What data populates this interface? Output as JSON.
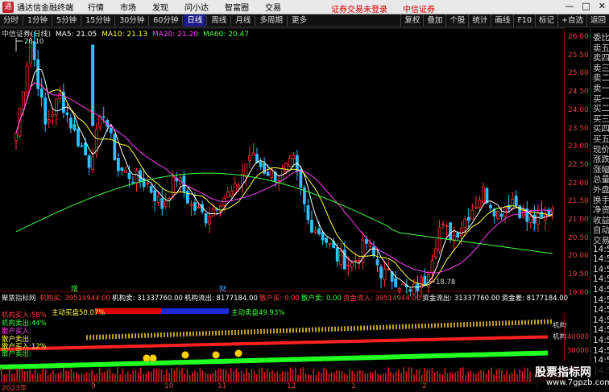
{
  "menubar": {
    "logo_text": "通",
    "app_title": "通达信金融终端",
    "items": [
      "行情",
      "市场",
      "发现",
      "问小达",
      "智富圈",
      "交易"
    ],
    "notice_left": "证券交易未登录",
    "notice_right": "中信证券",
    "win_buttons": [
      "—",
      "□",
      "✕"
    ]
  },
  "toolbar": {
    "periods": [
      "分时",
      "1分钟",
      "5分钟",
      "15分钟",
      "30分钟",
      "60分钟",
      "日线",
      "周线",
      "月线",
      "多周期",
      "更多"
    ],
    "active_period": "日线",
    "right_buttons": [
      "复权",
      "叠加",
      "个股",
      "统计",
      "画线",
      "F10",
      "标记",
      "+自选",
      "返回"
    ]
  },
  "legend": {
    "stock": "中信证券(日线)",
    "ma5": "MA5: 21.05",
    "ma10": "MA10: 21.13",
    "ma20": "MA20: 21.20",
    "ma60": "MA60: 20.47"
  },
  "price_axis": [
    "26.00",
    "25.50",
    "25.00",
    "24.50",
    "24.00",
    "23.50",
    "23.00",
    "22.50",
    "22.00",
    "21.50",
    "21.00",
    "20.50",
    "20.00",
    "19.50",
    "19.00"
  ],
  "annotations": {
    "high": "26.10",
    "low": "18.78",
    "marker1": "增",
    "marker2": "财"
  },
  "indicator": {
    "name": "聚票指标网",
    "items": [
      {
        "label": "机构买: 39514944.00",
        "color": "#ff4040"
      },
      {
        "label": "机构卖: 31337760.00",
        "color": "#ffffff"
      },
      {
        "label": "机构流出: 8177184.00",
        "color": "#ffffff"
      },
      {
        "label": "散户买: 0.00",
        "color": "#ff4040"
      },
      {
        "label": "散户卖: 0.00",
        "color": "#40ff40"
      },
      {
        "label": "资金流入: 39514944.00",
        "color": "#ff4040"
      },
      {
        "label": "资金流出: 31337760.00",
        "color": "#ffffff"
      },
      {
        "label": "资金差: 8177184.00",
        "color": "#ffffff"
      }
    ],
    "buy_pct": "机构买入:58%",
    "sell_pct": "机构卖出:44%",
    "retail_buy": "散户买入:",
    "retail_line2": "散户卖出:",
    "retail_in": "散户买入:12%",
    "retail_sell": "散户卖出:",
    "active_buy": "主动买盘50.07%",
    "active_sell": "主动卖盘49.93%",
    "side_label1": "机构",
    "side_label2": "机构"
  },
  "vol_axis": [
    "40000",
    "30000",
    "20000"
  ],
  "time_axis": [
    "2023年",
    "9",
    "10",
    "11",
    "12",
    "1",
    "2",
    "3"
  ],
  "info_col": [
    "委比",
    "卖五",
    "卖四",
    "卖三",
    "卖二",
    "卖一",
    "买一",
    "买二",
    "买三",
    "买四",
    "买五",
    "现价",
    "涨跌",
    "涨幅",
    "总量",
    "外盘",
    "换手",
    "净资",
    "收益",
    "自动",
    "交易",
    "14:5",
    "14:5",
    "14:5",
    "14:5",
    "14:5",
    "14:5",
    "14:5",
    "14:5",
    "14:5",
    "14:5",
    "14:5",
    "14:5",
    "14:5"
  ],
  "watermark": {
    "main": "股票指标网",
    "sub": "www.7gpzb.com"
  },
  "colors": {
    "up": "#ff3030",
    "down": "#30c0ff",
    "ma5": "#ffffff",
    "ma10": "#ffff40",
    "ma20": "#ff40ff",
    "ma60": "#40ff40"
  }
}
